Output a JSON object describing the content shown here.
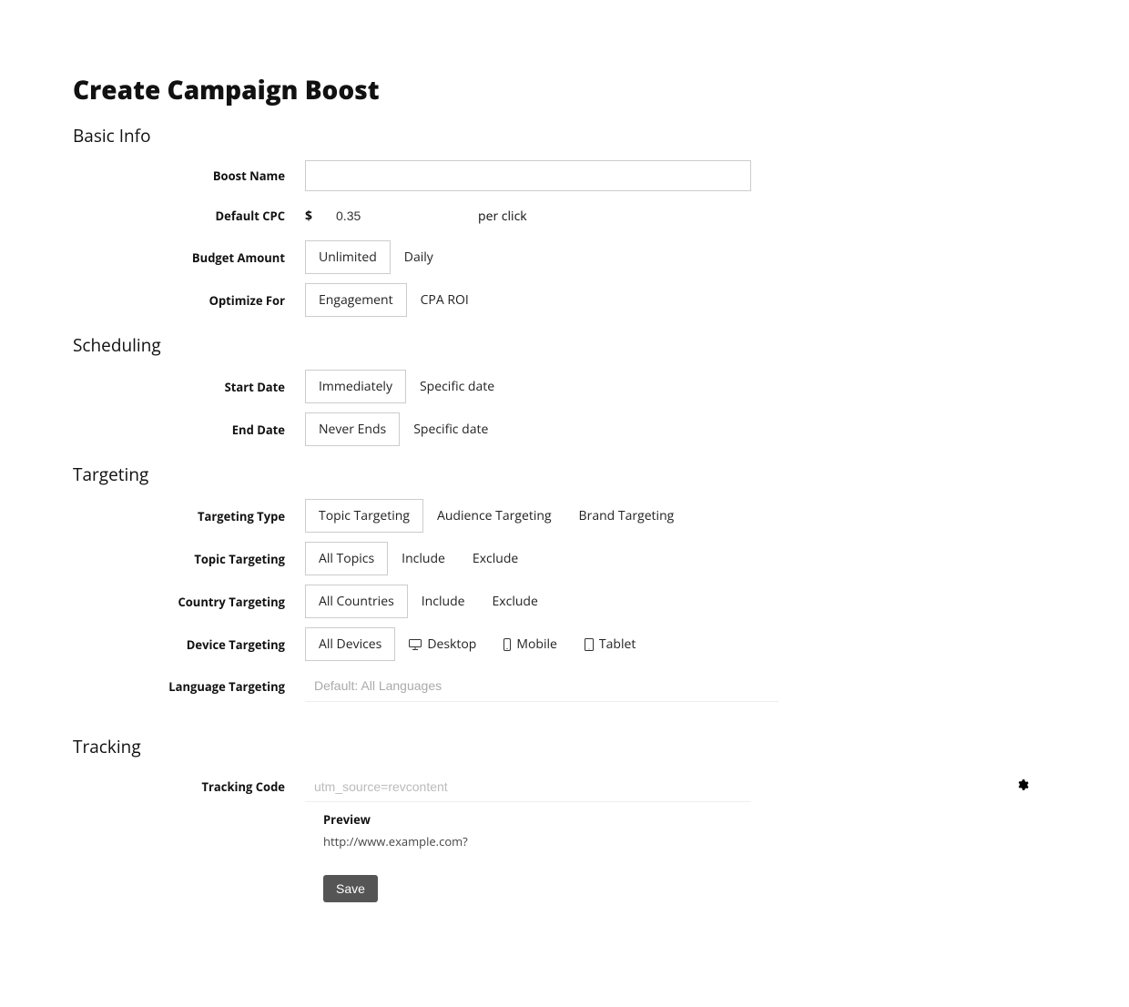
{
  "page_title": "Create Campaign Boost",
  "sections": {
    "basic_info": {
      "title": "Basic Info",
      "boost_name": {
        "label": "Boost Name",
        "value": ""
      },
      "default_cpc": {
        "label": "Default CPC",
        "currency": "$",
        "value": "0.35",
        "unit": "per click"
      },
      "budget_amount": {
        "label": "Budget Amount",
        "options": [
          "Unlimited",
          "Daily"
        ],
        "selected": "Unlimited"
      },
      "optimize_for": {
        "label": "Optimize For",
        "options": [
          "Engagement",
          "CPA ROI"
        ],
        "selected": "Engagement"
      }
    },
    "scheduling": {
      "title": "Scheduling",
      "start_date": {
        "label": "Start Date",
        "options": [
          "Immediately",
          "Specific date"
        ],
        "selected": "Immediately"
      },
      "end_date": {
        "label": "End Date",
        "options": [
          "Never Ends",
          "Specific date"
        ],
        "selected": "Never Ends"
      }
    },
    "targeting": {
      "title": "Targeting",
      "targeting_type": {
        "label": "Targeting Type",
        "options": [
          "Topic Targeting",
          "Audience Targeting",
          "Brand Targeting"
        ],
        "selected": "Topic Targeting"
      },
      "topic_targeting": {
        "label": "Topic Targeting",
        "options": [
          "All Topics",
          "Include",
          "Exclude"
        ],
        "selected": "All Topics"
      },
      "country_targeting": {
        "label": "Country Targeting",
        "options": [
          "All Countries",
          "Include",
          "Exclude"
        ],
        "selected": "All Countries"
      },
      "device_targeting": {
        "label": "Device Targeting",
        "options": [
          "All Devices",
          "Desktop",
          "Mobile",
          "Tablet"
        ],
        "selected": "All Devices"
      },
      "language_targeting": {
        "label": "Language Targeting",
        "placeholder": "Default: All Languages"
      }
    },
    "tracking": {
      "title": "Tracking",
      "tracking_code": {
        "label": "Tracking Code",
        "placeholder": "utm_source=revcontent",
        "value": ""
      },
      "preview_label": "Preview",
      "preview_url": "http://www.example.com?"
    }
  },
  "save_label": "Save"
}
